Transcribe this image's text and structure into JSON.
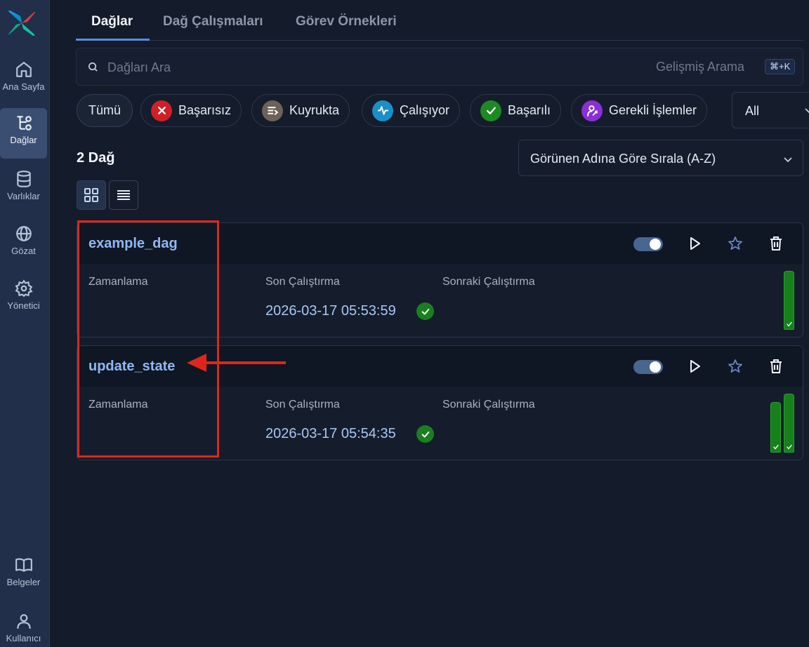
{
  "sidebar": {
    "items": [
      {
        "label": "Ana Sayfa",
        "icon": "home-icon"
      },
      {
        "label": "Dağlar",
        "icon": "dags-icon",
        "active": true
      },
      {
        "label": "Varlıklar",
        "icon": "database-icon"
      },
      {
        "label": "Gözat",
        "icon": "globe-icon"
      },
      {
        "label": "Yönetici",
        "icon": "gear-icon"
      }
    ],
    "bottom_items": [
      {
        "label": "Belgeler",
        "icon": "book-icon"
      },
      {
        "label": "Kullanıcı",
        "icon": "user-icon"
      }
    ]
  },
  "tabs": [
    {
      "label": "Dağlar",
      "active": true
    },
    {
      "label": "Dağ Çalışmaları"
    },
    {
      "label": "Görev Örnekleri"
    }
  ],
  "search": {
    "placeholder": "Dağları Ara",
    "advanced_label": "Gelişmiş Arama",
    "shortcut": "⌘+K"
  },
  "filters": {
    "chips": [
      {
        "label": "Tümü",
        "icon": null
      },
      {
        "label": "Başarısız",
        "icon": "x-icon",
        "color": "#d11f27"
      },
      {
        "label": "Kuyrukta",
        "icon": "queue-icon",
        "color": "#6d6259"
      },
      {
        "label": "Çalışıyor",
        "icon": "activity-icon",
        "color": "#1a8fc9"
      },
      {
        "label": "Başarılı",
        "icon": "check-icon",
        "color": "#1b8a22"
      },
      {
        "label": "Gerekli İşlemler",
        "icon": "user-action-icon",
        "color": "#8b2fd6"
      }
    ],
    "select_value": "All"
  },
  "list": {
    "count_label": "2 Dağ",
    "sort_value": "Görünen Adına Göre Sırala (A-Z)"
  },
  "dags": [
    {
      "dag_id": "example_dag",
      "schedule_label": "Zamanlama",
      "last_run_label": "Son Çalıştırma",
      "next_run_label": "Sonraki Çalıştırma",
      "last_run": "2026-03-17 05:53:59",
      "last_run_state": "success",
      "recent_runs": [
        1.0
      ]
    },
    {
      "dag_id": "update_state",
      "schedule_label": "Zamanlama",
      "last_run_label": "Son Çalıştırma",
      "next_run_label": "Sonraki Çalıştırma",
      "last_run": "2026-03-17 05:54:35",
      "last_run_state": "success",
      "recent_runs": [
        0.86,
        1.0
      ]
    }
  ],
  "colors": {
    "accent": "#5a8be3",
    "success": "#1b7f1f",
    "annotation": "#e0261b",
    "dag_link": "#8fb8f2"
  }
}
